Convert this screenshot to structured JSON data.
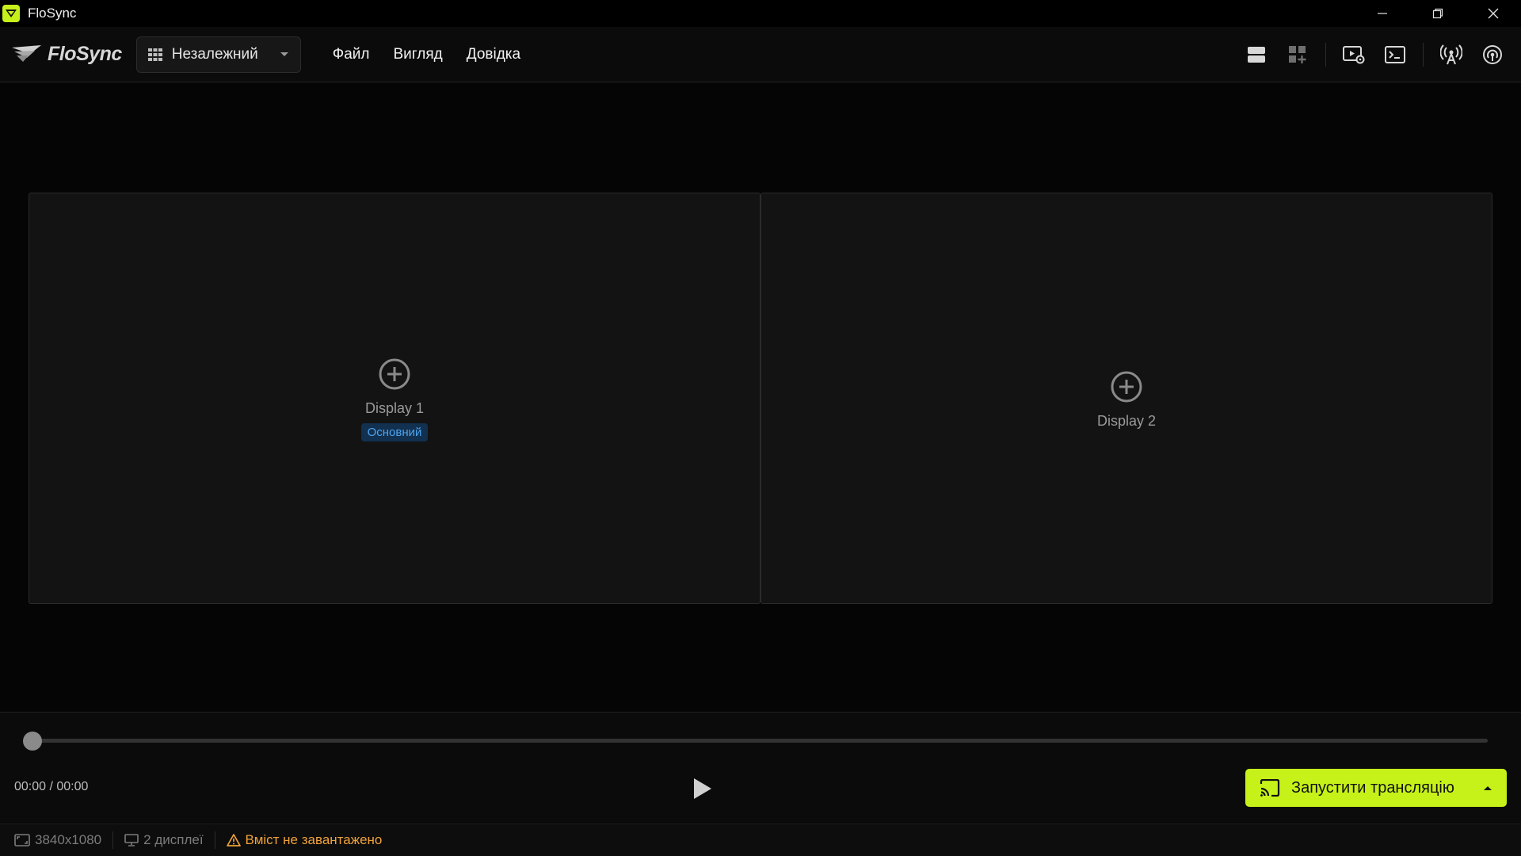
{
  "window": {
    "title": "FloSync",
    "icon": "flosync-logo-icon"
  },
  "brand": {
    "name": "FloSync"
  },
  "mode_select": {
    "value": "Незалежний",
    "icon": "grid-icon"
  },
  "menu": {
    "file": "Файл",
    "view": "Вигляд",
    "help": "Довідка"
  },
  "toolbar": {
    "icons": [
      "layout-rows-icon",
      "add-widget-icon",
      "media-settings-icon",
      "terminal-icon",
      "broadcast-tower-icon",
      "signal-icon"
    ]
  },
  "displays": [
    {
      "label": "Display 1",
      "badge": "Основний"
    },
    {
      "label": "Display 2",
      "badge": ""
    }
  ],
  "player": {
    "time": "00:00 / 00:00",
    "progress": 0
  },
  "cast_button": {
    "label": "Запустити трансляцію"
  },
  "status": {
    "resolution": "3840x1080",
    "displays": "2 дисплеї",
    "warning": "Вміст не завантажено"
  },
  "colors": {
    "accent": "#c6f219",
    "badge_text": "#4ea3ee",
    "warning": "#f0a23a"
  }
}
